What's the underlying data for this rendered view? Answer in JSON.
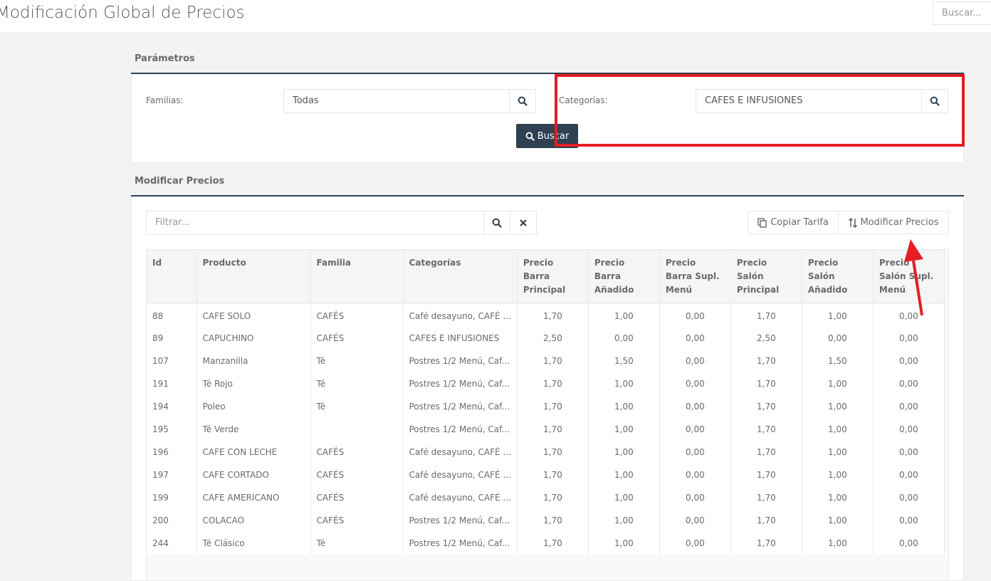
{
  "page": {
    "title": "Modificación Global de Precios",
    "search_placeholder": "Buscar..."
  },
  "parametros": {
    "title": "Parámetros",
    "familias_label": "Familias:",
    "familias_value": "Todas",
    "categorias_label": "Categorías:",
    "categorias_value": "CAFES E INFUSIONES",
    "buscar_label": "Buscar"
  },
  "modificar": {
    "title": "Modificar Precios",
    "filter_placeholder": "Filtrar...",
    "copiar_label": "Copiar Tarifa",
    "modificar_label": "Modificar Precios"
  },
  "table": {
    "headers": {
      "id": "Id",
      "producto": "Producto",
      "familia": "Familia",
      "categorias": "Categorías",
      "pbp": "Precio Barra Principal",
      "pba": "Precio Barra Añadido",
      "pbs": "Precio Barra Supl. Menú",
      "psp": "Precio Salón Principal",
      "psa": "Precio Salón Añadido",
      "pss": "Precio Salón Supl. Menú"
    },
    "rows": [
      {
        "id": "88",
        "producto": "CAFE SOLO",
        "familia": "CAFÉS",
        "categorias": "Café desayuno, CAFÉ ...",
        "pbp": "1,70",
        "pba": "1,00",
        "pbs": "0,00",
        "psp": "1,70",
        "psa": "1,00",
        "pss": "0,00"
      },
      {
        "id": "89",
        "producto": "CAPUCHINO",
        "familia": "CAFÉS",
        "categorias": "CAFES E INFUSIONES",
        "pbp": "2,50",
        "pba": "0,00",
        "pbs": "0,00",
        "psp": "2,50",
        "psa": "0,00",
        "pss": "0,00"
      },
      {
        "id": "107",
        "producto": "Manzanilla",
        "familia": "Té",
        "categorias": "Postres 1/2 Menú, Caf...",
        "pbp": "1,70",
        "pba": "1,50",
        "pbs": "0,00",
        "psp": "1,70",
        "psa": "1,50",
        "pss": "0,00"
      },
      {
        "id": "191",
        "producto": "Té Rojo",
        "familia": "Té",
        "categorias": "Postres 1/2 Menú, Caf...",
        "pbp": "1,70",
        "pba": "1,00",
        "pbs": "0,00",
        "psp": "1,70",
        "psa": "1,00",
        "pss": "0,00"
      },
      {
        "id": "194",
        "producto": "Poleo",
        "familia": "Té",
        "categorias": "Postres 1/2 Menú, Caf...",
        "pbp": "1,70",
        "pba": "1,00",
        "pbs": "0,00",
        "psp": "1,70",
        "psa": "1,00",
        "pss": "0,00"
      },
      {
        "id": "195",
        "producto": "Té Verde",
        "familia": "",
        "categorias": "Postres 1/2 Menú, Caf...",
        "pbp": "1,70",
        "pba": "1,00",
        "pbs": "0,00",
        "psp": "1,70",
        "psa": "1,00",
        "pss": "0,00"
      },
      {
        "id": "196",
        "producto": "CAFE CON LECHE",
        "familia": "CAFÉS",
        "categorias": "Café desayuno, CAFÉ ...",
        "pbp": "1,70",
        "pba": "1,00",
        "pbs": "0,00",
        "psp": "1,70",
        "psa": "1,00",
        "pss": "0,00"
      },
      {
        "id": "197",
        "producto": "CAFE CORTADO",
        "familia": "CAFÉS",
        "categorias": "Café desayuno, CAFÉ ...",
        "pbp": "1,70",
        "pba": "1,00",
        "pbs": "0,00",
        "psp": "1,70",
        "psa": "1,00",
        "pss": "0,00"
      },
      {
        "id": "199",
        "producto": "CAFE AMERICANO",
        "familia": "CAFÉS",
        "categorias": "Café desayuno, CAFÉ ...",
        "pbp": "1,70",
        "pba": "1,00",
        "pbs": "0,00",
        "psp": "1,70",
        "psa": "1,00",
        "pss": "0,00"
      },
      {
        "id": "200",
        "producto": "COLACAO",
        "familia": "CAFÉS",
        "categorias": "Postres 1/2 Menú, Caf...",
        "pbp": "1,70",
        "pba": "1,00",
        "pbs": "0,00",
        "psp": "1,70",
        "psa": "1,00",
        "pss": "0,00"
      },
      {
        "id": "244",
        "producto": "Té Clásico",
        "familia": "Té",
        "categorias": "Postres 1/2 Menú, Caf...",
        "pbp": "1,70",
        "pba": "1,00",
        "pbs": "0,00",
        "psp": "1,70",
        "psa": "1,00",
        "pss": "0,00"
      }
    ]
  },
  "colors": {
    "primary_dark": "#2f4050",
    "annotation_red": "#e31e24"
  },
  "icons": [
    "search-icon",
    "close-icon",
    "copy-icon",
    "sort-icon"
  ]
}
